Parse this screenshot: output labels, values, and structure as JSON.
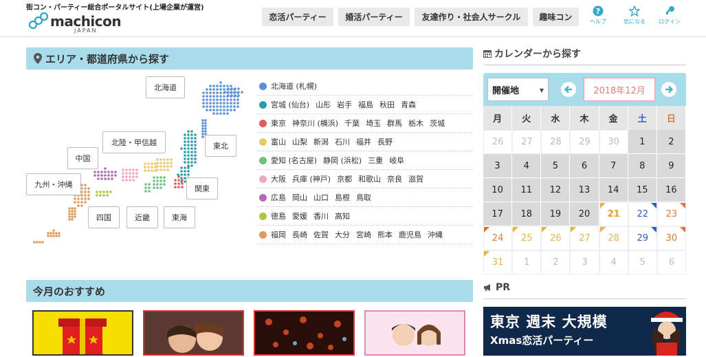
{
  "header": {
    "tagline": "街コン・パーティー総合ポータルサイト(上場企業が運営)",
    "logo_word": "machicon",
    "logo_sub": "JAPAN",
    "nav": [
      "恋活パーティー",
      "婚活パーティー",
      "友達作り・社会人サークル",
      "趣味コン"
    ],
    "icons": [
      {
        "label": "ヘルプ",
        "icon": "help-icon"
      },
      {
        "label": "気になる",
        "icon": "star-icon"
      },
      {
        "label": "ログイン",
        "icon": "key-icon"
      }
    ]
  },
  "area": {
    "title": "エリア・都道府県から探す",
    "map_buttons": [
      "北海道",
      "北陸・甲信越",
      "東北",
      "中国",
      "九州・沖縄",
      "関東",
      "四国",
      "近畿",
      "東海"
    ],
    "regions": [
      {
        "color": "#5b8fd6",
        "items": [
          "北海道 (札幌)"
        ]
      },
      {
        "color": "#2a9ba8",
        "items": [
          "宮城 (仙台)",
          "山形",
          "岩手",
          "福島",
          "秋田",
          "青森"
        ]
      },
      {
        "color": "#e25a5a",
        "items": [
          "東京",
          "神奈川 (横浜)",
          "千葉",
          "埼玉",
          "群馬",
          "栃木",
          "茨城"
        ]
      },
      {
        "color": "#e8c96a",
        "items": [
          "富山",
          "山梨",
          "新潟",
          "石川",
          "福井",
          "長野"
        ]
      },
      {
        "color": "#6fbf7f",
        "items": [
          "愛知 (名古屋)",
          "静岡 (浜松)",
          "三重",
          "岐阜"
        ]
      },
      {
        "color": "#f2a6bd",
        "items": [
          "大阪",
          "兵庫 (神戸)",
          "京都",
          "和歌山",
          "奈良",
          "滋賀"
        ]
      },
      {
        "color": "#b06ab8",
        "items": [
          "広島",
          "岡山",
          "山口",
          "島根",
          "鳥取"
        ]
      },
      {
        "color": "#a8c93b",
        "items": [
          "徳島",
          "愛媛",
          "香川",
          "高知"
        ]
      },
      {
        "color": "#e09a5e",
        "items": [
          "福岡",
          "長崎",
          "佐賀",
          "大分",
          "宮崎",
          "熊本",
          "鹿児島",
          "沖縄"
        ]
      }
    ]
  },
  "calendar": {
    "title": "カレンダーから探す",
    "venue_select": "開催地",
    "month": "2018年12月",
    "dow": [
      "月",
      "火",
      "水",
      "木",
      "金",
      "土",
      "日"
    ],
    "weeks": [
      [
        "26",
        "27",
        "28",
        "29",
        "30",
        "1",
        "2"
      ],
      [
        "3",
        "4",
        "5",
        "6",
        "7",
        "8",
        "9"
      ],
      [
        "10",
        "11",
        "12",
        "13",
        "14",
        "15",
        "16"
      ],
      [
        "17",
        "18",
        "19",
        "20",
        "21",
        "22",
        "23"
      ],
      [
        "24",
        "25",
        "26",
        "27",
        "28",
        "29",
        "30"
      ],
      [
        "31",
        "1",
        "2",
        "3",
        "4",
        "5",
        "6"
      ]
    ]
  },
  "recommend": {
    "title": "今月のおすすめ"
  },
  "pr": {
    "title": "PR",
    "banner_line1": "東京 週末 大規模",
    "banner_line2": "Xmas恋活パーティー"
  }
}
